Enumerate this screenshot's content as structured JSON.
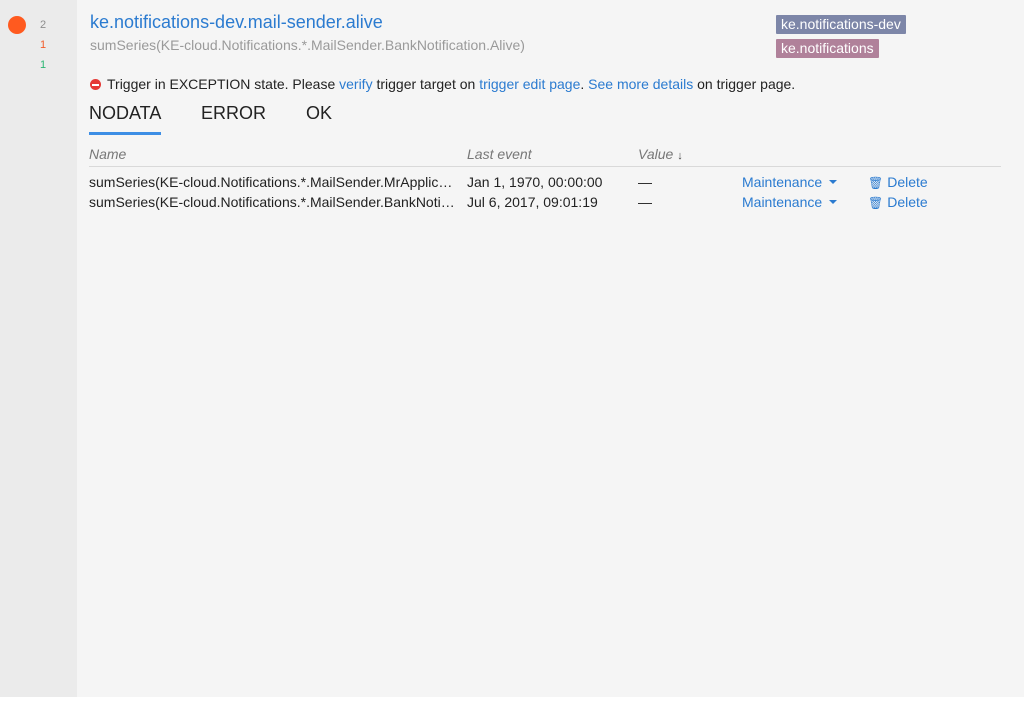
{
  "sidebar": {
    "counts": {
      "total": "2",
      "error": "1",
      "ok": "1"
    },
    "state_color": "#ff5a1f"
  },
  "trigger": {
    "name": "ke.notifications-dev.mail-sender.alive",
    "target": "sumSeries(KE-cloud.Notifications.*.MailSender.BankNotification.Alive)",
    "tags": [
      {
        "label": "ke.notifications-dev",
        "color": "#7d86a8"
      },
      {
        "label": "ke.notifications",
        "color": "#b0819a"
      }
    ]
  },
  "exception": {
    "icon": "error-circle-icon",
    "part1": "Trigger in EXCEPTION state. Please ",
    "link1": "verify",
    "part2": " trigger target on ",
    "link2": "trigger edit page",
    "part3": ". ",
    "link3": "See more details",
    "part4": " on trigger page."
  },
  "tabs": [
    {
      "label": "NODATA",
      "active": true
    },
    {
      "label": "ERROR",
      "active": false
    },
    {
      "label": "OK",
      "active": false
    }
  ],
  "table": {
    "headers": {
      "name": "Name",
      "last_event": "Last event",
      "value": "Value",
      "sort_icon": "↓"
    },
    "rows": [
      {
        "name": "sumSeries(KE-cloud.Notifications.*.MailSender.MrApplicationNotification.Alive)",
        "last_event": "Jan 1, 1970, 00:00:00",
        "value": "—",
        "maintenance": "Maintenance",
        "delete": "Delete"
      },
      {
        "name": "sumSeries(KE-cloud.Notifications.*.MailSender.BankNotification.Alive)",
        "last_event": "Jul 6, 2017, 09:01:19",
        "value": "—",
        "maintenance": "Maintenance",
        "delete": "Delete"
      }
    ]
  },
  "colors": {
    "link": "#2b7bd0",
    "tab_underline": "#3d8ee5",
    "error": "#f25c2a",
    "ok": "#2bb673"
  }
}
